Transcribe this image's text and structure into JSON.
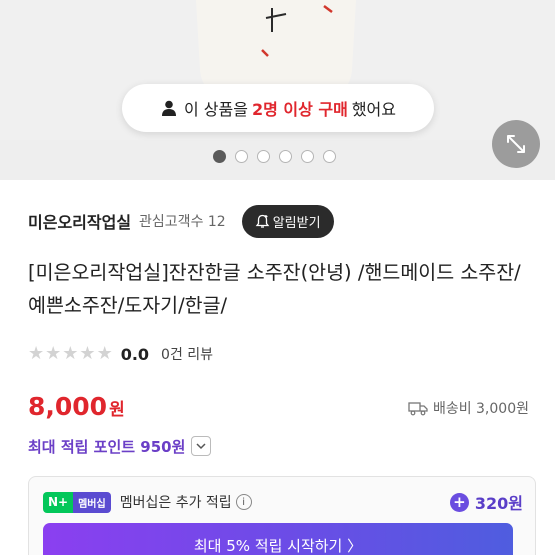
{
  "hero": {
    "purchase_prefix": "이 상품을",
    "purchase_highlight": "2명 이상 구매",
    "purchase_suffix": "했어요",
    "slide_count": 6,
    "active_slide": 1
  },
  "store": {
    "name": "미은오리작업실",
    "followers": "관심고객수 12",
    "alarm_label": "알림받기"
  },
  "product": {
    "title": "[미은오리작업실]잔잔한글 소주잔(안녕) /핸드메이드 소주잔/예쁜소주잔/도자기/한글/",
    "rating_score": "0.0",
    "review_count": "0건 리뷰",
    "stars": [
      "★",
      "★",
      "★",
      "★",
      "★"
    ],
    "price": "8,000",
    "price_unit": "원",
    "shipping": "배송비 3,000원"
  },
  "points": {
    "label": "최대 적립 포인트 950원"
  },
  "membership": {
    "badge_n": "N+",
    "badge_label": "멤버십",
    "text": "멤버십은 추가 적립",
    "info": "i",
    "points": "320원",
    "cta": "최대 5% 적립 시작하기 〉"
  },
  "colors": {
    "price_red": "#e0262d",
    "points_purple": "#6b3fc7",
    "naver_green": "#03c75a"
  }
}
